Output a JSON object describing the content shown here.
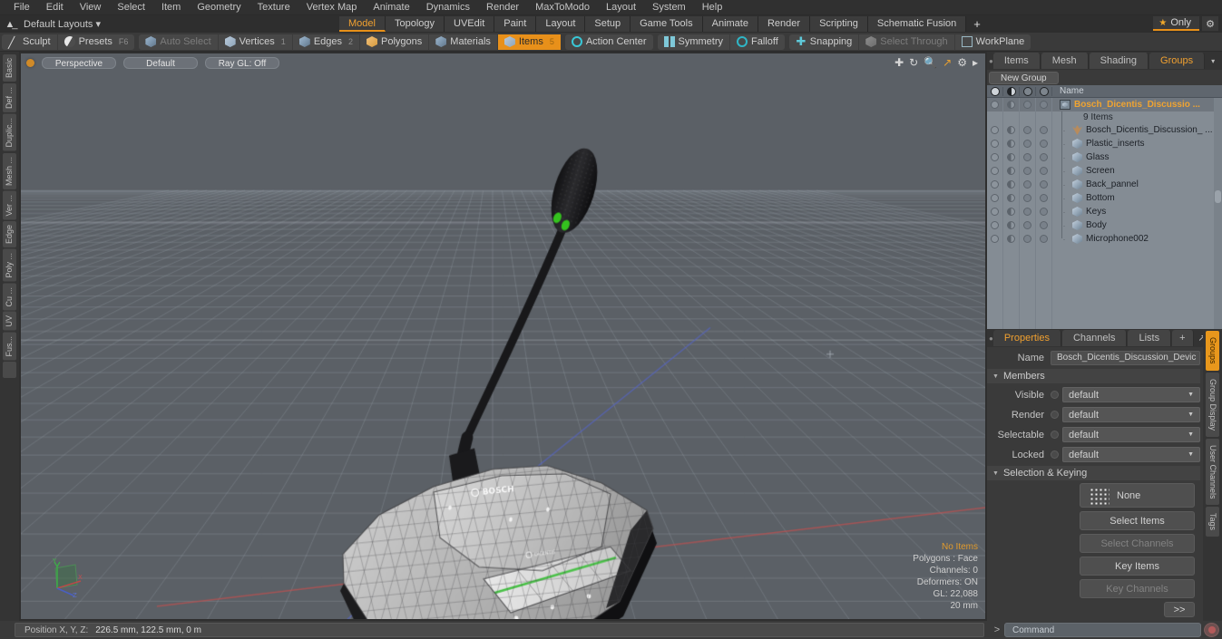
{
  "app": {
    "title": "Modo"
  },
  "menu": {
    "items": [
      "File",
      "Edit",
      "View",
      "Select",
      "Item",
      "Geometry",
      "Texture",
      "Vertex Map",
      "Animate",
      "Dynamics",
      "Render",
      "MaxToModo",
      "Layout",
      "System",
      "Help"
    ]
  },
  "layout_bar": {
    "home_icon": "home-icon",
    "default_layouts": "Default Layouts",
    "caret": "▾",
    "tabs": [
      {
        "label": "Model",
        "active": true
      },
      {
        "label": "Topology",
        "active": false
      },
      {
        "label": "UVEdit",
        "active": false
      },
      {
        "label": "Paint",
        "active": false
      },
      {
        "label": "Layout",
        "active": false
      },
      {
        "label": "Setup",
        "active": false
      },
      {
        "label": "Game Tools",
        "active": false
      },
      {
        "label": "Animate",
        "active": false
      },
      {
        "label": "Render",
        "active": false
      },
      {
        "label": "Scripting",
        "active": false
      },
      {
        "label": "Schematic Fusion",
        "active": false
      }
    ],
    "add_tab": "+",
    "only_label": "Only",
    "star_icon": "star-icon",
    "gear_icon": "gear-icon",
    "accent": "#e8901a"
  },
  "toolbar": {
    "group1": [
      {
        "label": "Sculpt",
        "icon": "pencil-icon",
        "active": false,
        "disabled": false,
        "num": ""
      },
      {
        "label": "Presets",
        "icon": "sphere-icon",
        "active": false,
        "disabled": false,
        "num": "F6"
      }
    ],
    "group2": [
      {
        "label": "Auto Select",
        "icon": "cube-icon",
        "active": false,
        "disabled": true,
        "num": ""
      },
      {
        "label": "Vertices",
        "icon": "cube-icon",
        "active": false,
        "disabled": false,
        "num": "1"
      },
      {
        "label": "Edges",
        "icon": "cube-icon",
        "active": false,
        "disabled": false,
        "num": "2"
      },
      {
        "label": "Polygons",
        "icon": "cube-icon",
        "active": false,
        "disabled": false,
        "num": ""
      },
      {
        "label": "Materials",
        "icon": "cube-icon",
        "active": false,
        "disabled": false,
        "num": ""
      },
      {
        "label": "Items",
        "icon": "cube-icon",
        "active": true,
        "disabled": false,
        "num": "5"
      }
    ],
    "group3": [
      {
        "label": "Action Center",
        "icon": "target-icon",
        "active": false,
        "disabled": false,
        "num": ""
      }
    ],
    "group4": [
      {
        "label": "Symmetry",
        "icon": "symmetry-icon",
        "active": false,
        "disabled": false,
        "num": ""
      },
      {
        "label": "Falloff",
        "icon": "falloff-icon",
        "active": false,
        "disabled": false,
        "num": ""
      }
    ],
    "group5": [
      {
        "label": "Snapping",
        "icon": "snap-icon",
        "active": false,
        "disabled": false,
        "num": ""
      },
      {
        "label": "Select Through",
        "icon": "select-through-icon",
        "active": false,
        "disabled": true,
        "num": ""
      },
      {
        "label": "WorkPlane",
        "icon": "workplane-icon",
        "active": false,
        "disabled": false,
        "num": ""
      }
    ]
  },
  "left_tabs": [
    "Basic",
    "Def ...",
    "Duplic...",
    "Mesh ...",
    "Ver ...",
    "Edge",
    "Poly ...",
    "Cu ...",
    "UV",
    "Fus..."
  ],
  "viewport": {
    "view_mode": "Perspective",
    "shading": "Default",
    "raygl": "Ray GL: Off",
    "nav_icons": [
      "move-icon",
      "rotate-icon",
      "zoom-icon",
      "maximize-icon",
      "gear-icon",
      "arrow-right-icon"
    ],
    "stats": {
      "selection": "No Items",
      "polygons": "Polygons : Face",
      "channels": "Channels: 0",
      "deformers": "Deformers: ON",
      "gl": "GL: 22,088",
      "grid": "20 mm"
    },
    "axis_gizmo": {
      "x": "X",
      "y": "Y",
      "z": "Z",
      "x_color": "#c44444",
      "y_color": "#44b04a",
      "z_color": "#4a63c8"
    },
    "bg_color": "#5b6066",
    "grid_color": "#6b7076"
  },
  "status_bar": {
    "label": "Position X, Y, Z:",
    "value": "226.5 mm, 122.5 mm, 0 m"
  },
  "right_panel": {
    "top_tabs": [
      {
        "label": "Items",
        "active": false
      },
      {
        "label": "Mesh ...",
        "active": false
      },
      {
        "label": "Shading",
        "active": false
      },
      {
        "label": "Groups",
        "active": true
      }
    ],
    "top_tab_caret": "▾",
    "expand_icon": "expand-icon",
    "arrow_icon": "arrow-right-icon",
    "new_group_button": "New Group",
    "list_header": {
      "columns": [
        "visible-icon",
        "render-icon",
        "selectable-icon",
        "locked-icon"
      ],
      "name": "Name"
    },
    "group": {
      "name": "Bosch_Dicentis_Discussio ...",
      "count": "9 Items",
      "icon": "group-icon"
    },
    "items": [
      {
        "name": "Bosch_Dicentis_Discussion_ ...",
        "icon": "locator-icon"
      },
      {
        "name": "Plastic_inserts",
        "icon": "mesh-icon"
      },
      {
        "name": "Glass",
        "icon": "mesh-icon"
      },
      {
        "name": "Screen",
        "icon": "mesh-icon"
      },
      {
        "name": "Back_pannel",
        "icon": "mesh-icon"
      },
      {
        "name": "Bottom",
        "icon": "mesh-icon"
      },
      {
        "name": "Keys",
        "icon": "mesh-icon"
      },
      {
        "name": "Body",
        "icon": "mesh-icon"
      },
      {
        "name": "Microphone002",
        "icon": "mesh-icon"
      }
    ]
  },
  "properties": {
    "tabs": [
      {
        "label": "Properties",
        "active": true
      },
      {
        "label": "Channels",
        "active": false
      },
      {
        "label": "Lists",
        "active": false
      }
    ],
    "add_tab": "+",
    "name_label": "Name",
    "name_value": "Bosch_Dicentis_Discussion_Devic",
    "members_header": "Members",
    "members": [
      {
        "label": "Visible",
        "value": "default"
      },
      {
        "label": "Render",
        "value": "default"
      },
      {
        "label": "Selectable",
        "value": "default"
      },
      {
        "label": "Locked",
        "value": "default"
      }
    ],
    "selection_header": "Selection & Keying",
    "buttons": [
      {
        "label": "None",
        "disabled": false,
        "dots": true
      },
      {
        "label": "Select Items",
        "disabled": false,
        "dots": false
      },
      {
        "label": "Select Channels",
        "disabled": true,
        "dots": false
      },
      {
        "label": "Key Items",
        "disabled": false,
        "dots": false
      },
      {
        "label": "Key Channels",
        "disabled": true,
        "dots": false
      }
    ],
    "forward_button": ">>"
  },
  "right_tabs": [
    {
      "label": "Groups",
      "active": true
    },
    {
      "label": "Group Display",
      "active": false
    },
    {
      "label": "User Channels",
      "active": false
    },
    {
      "label": "Tags",
      "active": false
    }
  ],
  "command_bar": {
    "prompt": ">",
    "placeholder": "Command",
    "record_icon": "record-icon"
  }
}
